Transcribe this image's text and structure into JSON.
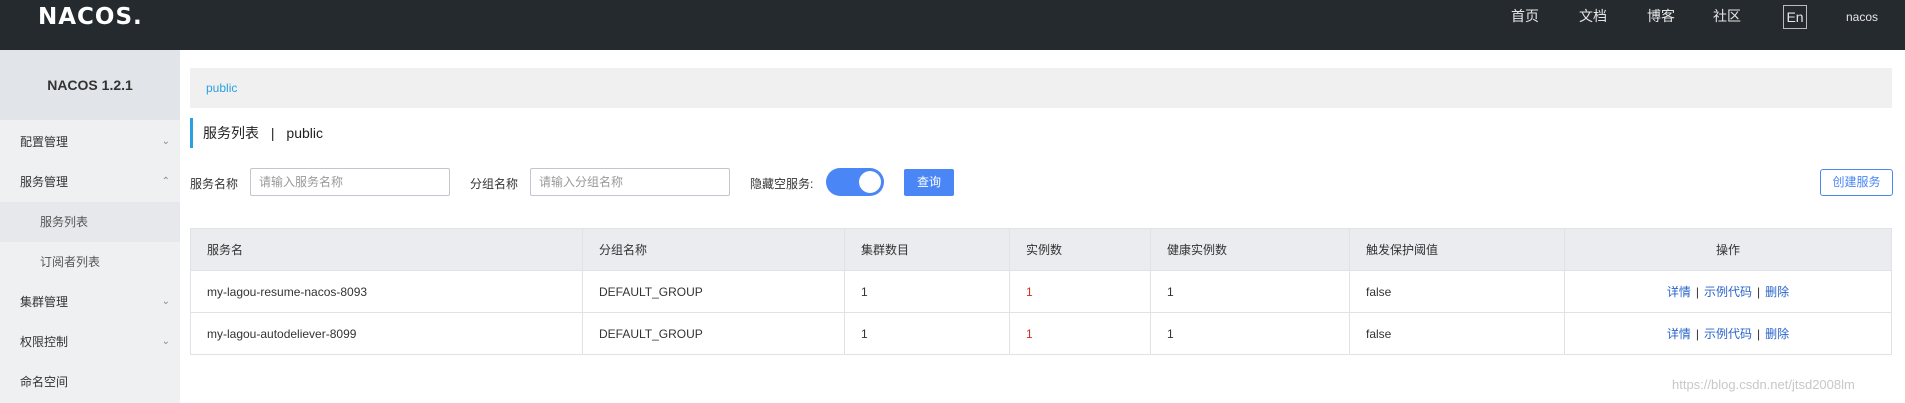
{
  "header": {
    "logo_text": "NACOS.",
    "nav": [
      "首页",
      "文档",
      "博客",
      "社区"
    ],
    "lang_button": "En",
    "user": "nacos"
  },
  "sidebar": {
    "title": "NACOS 1.2.1",
    "items": [
      {
        "label": "配置管理",
        "expanded": false
      },
      {
        "label": "服务管理",
        "expanded": true
      },
      {
        "label": "服务列表",
        "sub": true,
        "active": true
      },
      {
        "label": "订阅者列表",
        "sub": true,
        "active": false
      },
      {
        "label": "集群管理",
        "expanded": false
      },
      {
        "label": "权限控制",
        "expanded": false
      },
      {
        "label": "命名空间"
      }
    ]
  },
  "breadcrumb": "public",
  "page": {
    "title": "服务列表",
    "separator": "|",
    "namespace": "public"
  },
  "filters": {
    "service_name_label": "服务名称",
    "service_name_placeholder": "请输入服务名称",
    "group_name_label": "分组名称",
    "group_name_placeholder": "请输入分组名称",
    "hide_empty_label": "隐藏空服务:",
    "hide_empty_on": true,
    "query_button": "查询",
    "create_button": "创建服务"
  },
  "table": {
    "columns": [
      "服务名",
      "分组名称",
      "集群数目",
      "实例数",
      "健康实例数",
      "触发保护阈值",
      "操作"
    ],
    "rows": [
      {
        "service": "my-lagou-resume-nacos-8093",
        "group": "DEFAULT_GROUP",
        "clusters": "1",
        "instances": "1",
        "healthy": "1",
        "protect": "false"
      },
      {
        "service": "my-lagou-autodeliever-8099",
        "group": "DEFAULT_GROUP",
        "clusters": "1",
        "instances": "1",
        "healthy": "1",
        "protect": "false"
      }
    ],
    "actions": {
      "detail": "详情",
      "sample": "示例代码",
      "delete": "删除",
      "pipe": "|"
    }
  },
  "watermark": "https://blog.csdn.net/jtsd2008lm",
  "colors": {
    "header_bg": "#252a2f",
    "accent": "#4a86f5",
    "link": "#2a64c8",
    "highlight": "#2aa0e0"
  }
}
